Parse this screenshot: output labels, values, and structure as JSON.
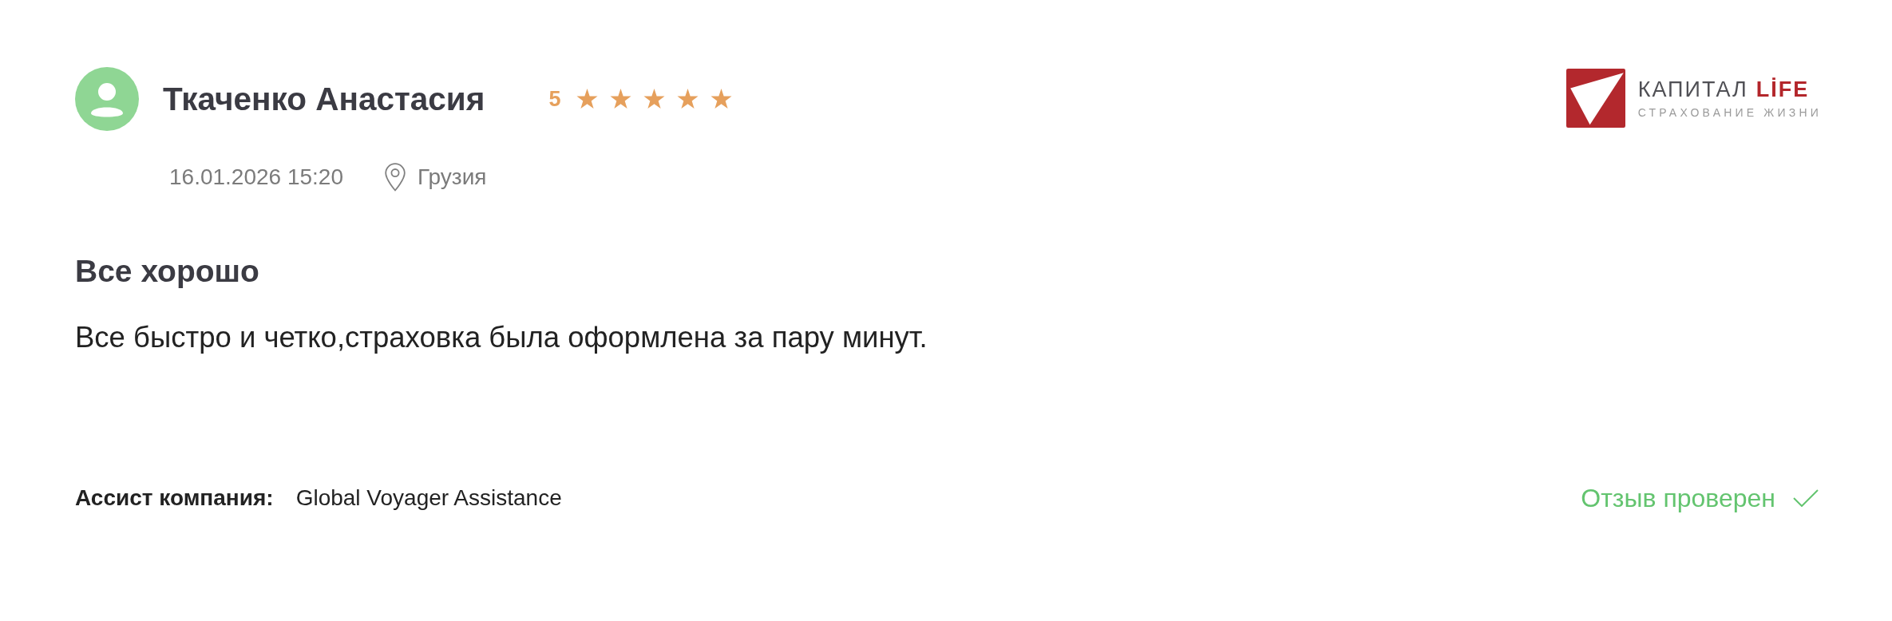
{
  "review": {
    "author": {
      "name": "Ткаченко Анастасия"
    },
    "rating": {
      "score": "5",
      "stars": 5
    },
    "date": "16.01.2026 15:20",
    "location": "Грузия",
    "title": "Все хорошо",
    "text": "Все быстро и четко,страховка была оформлена за пару минут.",
    "assist": {
      "label": "Ассист компания:",
      "value": "Global Voyager Assistance"
    },
    "verification": {
      "verified": true,
      "label": "Отзыв проверен"
    }
  },
  "company_logo": {
    "name": "КАПИТАЛ",
    "accent": "LİFE",
    "tagline": "СТРАХОВАНИЕ ЖИЗНИ"
  }
}
